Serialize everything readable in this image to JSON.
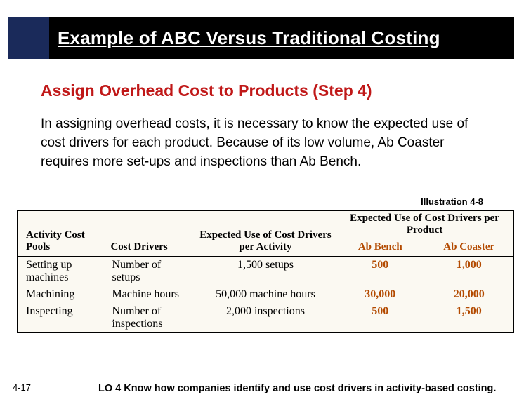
{
  "title": "Example of ABC Versus Traditional Costing",
  "subtitle": "Assign Overhead Cost to Products (Step 4)",
  "body": "In assigning overhead costs, it is necessary to know the expected use of cost drivers for each product. Because of its low volume, Ab Coaster requires more set-ups and inspections than Ab Bench.",
  "illustration_label": "Illustration 4-8",
  "table": {
    "headers": {
      "pool": "Activity Cost Pools",
      "driver": "Cost Drivers",
      "activity": "Expected Use of Cost Drivers per Activity",
      "group": "Expected Use of Cost Drivers per Product",
      "bench": "Ab Bench",
      "coaster": "Ab Coaster"
    },
    "rows": [
      {
        "pool": "Setting up machines",
        "driver": "Number of setups",
        "activity": "1,500 setups",
        "bench": "500",
        "coaster": "1,000"
      },
      {
        "pool": "Machining",
        "driver": "Machine hours",
        "activity": "50,000 machine hours",
        "bench": "30,000",
        "coaster": "20,000"
      },
      {
        "pool": "Inspecting",
        "driver": "Number of inspections",
        "activity": "2,000 inspections",
        "bench": "500",
        "coaster": "1,500"
      }
    ]
  },
  "page_number": "4-17",
  "learning_objective": "LO 4  Know how companies identify and use cost drivers in activity-based costing.",
  "chart_data": {
    "type": "table",
    "title": "Expected Use of Cost Drivers",
    "columns": [
      "Activity Cost Pools",
      "Cost Drivers",
      "Expected Use of Cost Drivers per Activity",
      "Ab Bench",
      "Ab Coaster"
    ],
    "rows": [
      [
        "Setting up machines",
        "Number of setups",
        "1,500 setups",
        500,
        1000
      ],
      [
        "Machining",
        "Machine hours",
        "50,000 machine hours",
        30000,
        20000
      ],
      [
        "Inspecting",
        "Number of inspections",
        "2,000 inspections",
        500,
        1500
      ]
    ]
  }
}
